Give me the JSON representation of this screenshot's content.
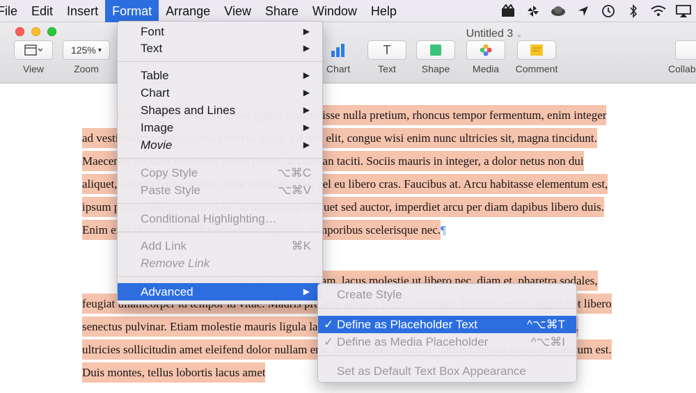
{
  "menubar": {
    "items": [
      "File",
      "Edit",
      "Insert",
      "Format",
      "Arrange",
      "View",
      "Share",
      "Window",
      "Help"
    ],
    "active_index": 3
  },
  "status_icons": [
    "app-icon",
    "pinwheel-icon",
    "cloud-icon",
    "location-arrow-icon",
    "time-machine-icon",
    "bluetooth-icon",
    "wifi-icon",
    "airplay-icon"
  ],
  "window": {
    "title": "Untitled 3"
  },
  "toolbar": {
    "view_label": "View",
    "zoom_value": "125%",
    "zoom_label": "Zoom",
    "chart_label": "Chart",
    "text_label": "Text",
    "text_glyph": "T",
    "shape_label": "Shape",
    "media_label": "Media",
    "comment_label": "Comment",
    "collab_label": "Collab"
  },
  "document": {
    "paragraph1": "Lorem ipsum dolor sit amet, ligula suspendisse nulla pretium, rhoncus tempor fermentum, enim integer ad vestibulum volutpat. Nisl rhoncus turpis est, vel elit, congue wisi enim nunc ultricies sit, magna tincidunt. Maecenas aliquam maecenas ligula nostra, accumsan taciti. Sociis mauris in integer, a dolor netus non dui aliquet, sagittis felis sodales, dolor sociis mauris, vel eu libero cras. Faucibus at. Arcu habitasse elementum est, ipsum purus pede porttitor class, ut adipiscing, aliquet sed auctor, imperdiet arcu per diam dapibus libero duis. Enim eros in vel, volutpat nec pellentesque leo, temporibus scelerisque nec.",
    "pilcrow": "¶",
    "paragraph2": "Ac dolor ac adipiscing amet bibendum nullam, lacus molestie ut libero nec, diam et, pharetra sodales, feugiat ullamcorper id tempor id vitae. Mauris pretium aliquet, lectus tincidunt. Porttitor mollis imperdiet libero senectus pulvinar. Etiam molestie mauris ligula laoreet, vehicula eleifend. Repellat orci erat et, sem cum, ultricies sollicitudin amet eleifend dolor nullam erat, malesuada est leo ac. Varius natoque turpis elementum est. Duis montes, tellus lobortis lacus amet"
  },
  "format_menu": {
    "items": [
      {
        "label": "Font",
        "submenu": true
      },
      {
        "label": "Text",
        "submenu": true
      },
      {
        "label": "Table",
        "submenu": true
      },
      {
        "label": "Chart",
        "submenu": true
      },
      {
        "label": "Shapes and Lines",
        "submenu": true
      },
      {
        "label": "Image",
        "submenu": true
      },
      {
        "label": "Movie",
        "submenu": true
      },
      {
        "label": "Copy Style",
        "shortcut": "⌥⌘C",
        "disabled": true
      },
      {
        "label": "Paste Style",
        "shortcut": "⌥⌘V",
        "disabled": true
      },
      {
        "label": "Conditional Highlighting…",
        "disabled": true
      },
      {
        "label": "Add Link",
        "shortcut": "⌘K",
        "disabled": true
      },
      {
        "label": "Remove Link",
        "disabled": true
      },
      {
        "label": "Advanced",
        "submenu": true,
        "highlighted": true
      }
    ]
  },
  "advanced_submenu": {
    "items": [
      {
        "label": "Create Style",
        "disabled": true
      },
      {
        "label": "Define as Placeholder Text",
        "shortcut": "^⌥⌘T",
        "checked": true,
        "highlighted": true
      },
      {
        "label": "Define as Media Placeholder",
        "shortcut": "^⌥⌘I",
        "checked": true,
        "disabled": true
      },
      {
        "label": "Set as Default Text Box Appearance",
        "disabled": true
      }
    ]
  },
  "colors": {
    "accent": "#2c6ee0",
    "text_highlight": "#f6c3ad",
    "menubar_bg": "#eceaf0"
  }
}
